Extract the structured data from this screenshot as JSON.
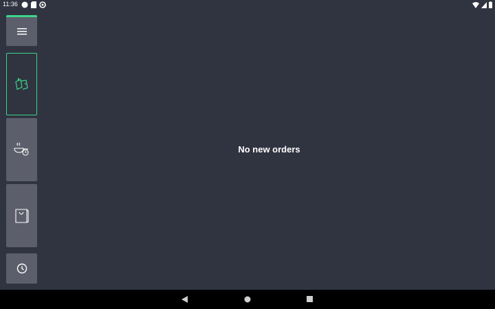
{
  "status_bar": {
    "time": "11:36",
    "left_icons": [
      "circle-notification-icon",
      "sd-card-icon",
      "sync-icon"
    ],
    "right_icons": [
      "wifi-icon",
      "signal-icon",
      "battery-icon"
    ]
  },
  "sidebar": {
    "accent_color": "#3dd68c",
    "items": [
      {
        "icon": "hamburger-menu-icon",
        "active": false
      },
      {
        "icon": "new-orders-icon",
        "active": true
      },
      {
        "icon": "cooking-pan-timer-icon",
        "active": false
      },
      {
        "icon": "shopping-bag-icon",
        "active": false
      },
      {
        "icon": "clock-icon",
        "active": false
      }
    ]
  },
  "main": {
    "empty_message": "No new orders"
  },
  "nav_bar": {
    "buttons": [
      "back-icon",
      "home-icon",
      "recents-icon"
    ]
  },
  "colors": {
    "background": "#303340",
    "tile": "#5c5f6b",
    "accent": "#3dd68c"
  }
}
